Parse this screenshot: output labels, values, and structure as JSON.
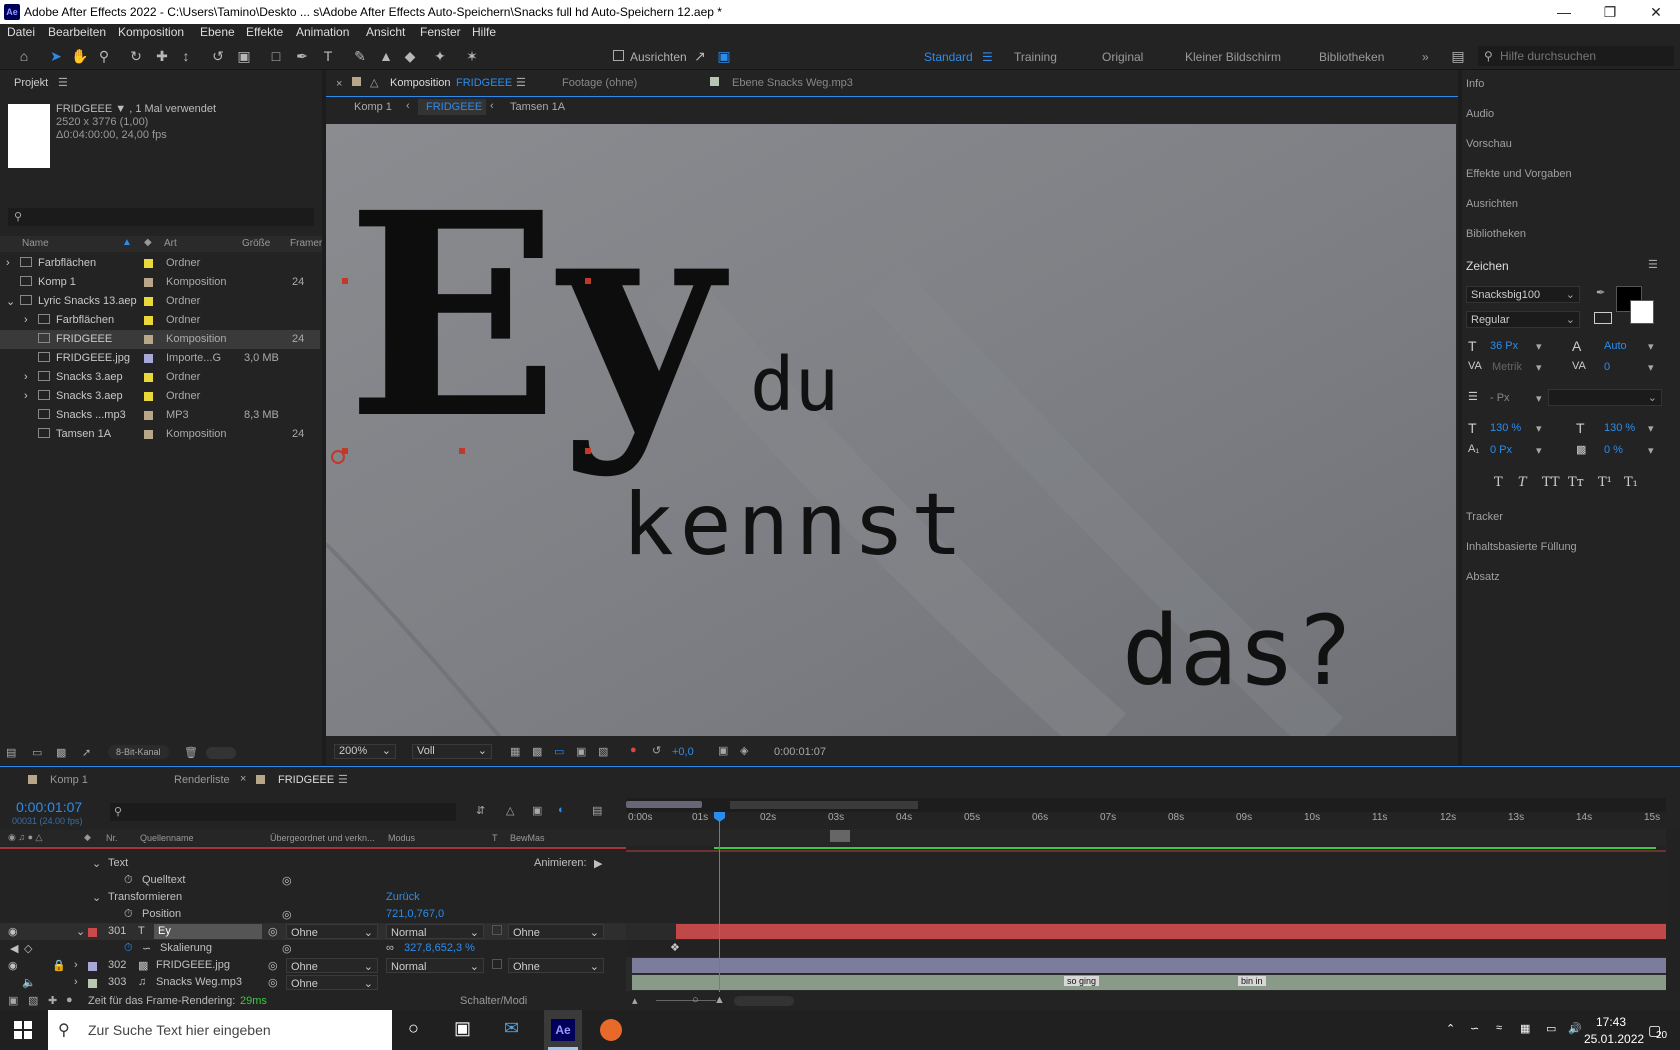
{
  "window": {
    "title": "Adobe After Effects 2022 - C:\\Users\\Tamino\\Deskto ... s\\Adobe After Effects Auto-Speichern\\Snacks full hd Auto-Speichern 12.aep *",
    "logo": "Ae"
  },
  "menu": [
    "Datei",
    "Bearbeiten",
    "Komposition",
    "Ebene",
    "Effekte",
    "Animation",
    "Ansicht",
    "Fenster",
    "Hilfe"
  ],
  "toolbar": {
    "snap_label": "Ausrichten",
    "workspaces": [
      "Standard",
      "Training",
      "Original",
      "Kleiner Bildschirm",
      "Bibliotheken"
    ],
    "help_placeholder": "Hilfe durchsuchen"
  },
  "project": {
    "title": "Projekt",
    "selected_name": "FRIDGEEE ▼ , 1 Mal verwendet",
    "selected_dims": "2520 x 3776 (1,00)",
    "selected_duration": "Δ0:04:00:00, 24,00 fps",
    "columns": [
      "Name",
      "Art",
      "Größe",
      "Framer"
    ],
    "items": [
      {
        "name": "Farbflächen",
        "type": "Ordner",
        "size": "",
        "fr": "",
        "indent": 0,
        "arrow": "›",
        "swatch": "#e8d83a"
      },
      {
        "name": "Komp 1",
        "type": "Komposition",
        "size": "",
        "fr": "24",
        "indent": 0,
        "arrow": "",
        "swatch": "#b8a68a"
      },
      {
        "name": "Lyric Snacks 13.aep",
        "type": "Ordner",
        "size": "",
        "fr": "",
        "indent": 0,
        "arrow": "⌄",
        "swatch": "#e8d83a"
      },
      {
        "name": "Farbflächen",
        "type": "Ordner",
        "size": "",
        "fr": "",
        "indent": 1,
        "arrow": "›",
        "swatch": "#e8d83a"
      },
      {
        "name": "FRIDGEEE",
        "type": "Komposition",
        "size": "",
        "fr": "24",
        "indent": 1,
        "arrow": "",
        "swatch": "#b8a68a"
      },
      {
        "name": "FRIDGEEE.jpg",
        "type": "Importe...G",
        "size": "3,0 MB",
        "fr": "",
        "indent": 1,
        "arrow": "",
        "swatch": "#a8a8d8"
      },
      {
        "name": "Snacks 3.aep",
        "type": "Ordner",
        "size": "",
        "fr": "",
        "indent": 1,
        "arrow": "›",
        "swatch": "#e8d83a"
      },
      {
        "name": "Snacks 3.aep",
        "type": "Ordner",
        "size": "",
        "fr": "",
        "indent": 1,
        "arrow": "›",
        "swatch": "#e8d83a"
      },
      {
        "name": "Snacks ...mp3",
        "type": "MP3",
        "size": "8,3 MB",
        "fr": "",
        "indent": 1,
        "arrow": "",
        "swatch": "#b8a68a"
      },
      {
        "name": "Tamsen 1A",
        "type": "Komposition",
        "size": "",
        "fr": "24",
        "indent": 1,
        "arrow": "",
        "swatch": "#b8a68a"
      }
    ],
    "bit_depth": "8-Bit-Kanal"
  },
  "comp": {
    "tab_prefix": "Komposition",
    "tab_name": "FRIDGEEE",
    "footage_tab": "Footage (ohne)",
    "layer_tab": "Ebene Snacks Weg.mp3",
    "breadcrumbs": [
      "Komp 1",
      "FRIDGEEE",
      "Tamsen 1A"
    ],
    "words": [
      "Ey",
      "du",
      "kennst",
      "das?"
    ],
    "zoom": "200%",
    "resolution": "Voll",
    "exposure": "+0,0",
    "timecode": "0:00:01:07"
  },
  "right_panel": {
    "items_top": [
      "Info",
      "Audio",
      "Vorschau",
      "Effekte und Vorgaben",
      "Ausrichten",
      "Bibliotheken"
    ],
    "zeichen": "Zeichen",
    "font": "Snacksbig100",
    "style": "Regular",
    "size": "36 Px",
    "leading": "Auto",
    "kerning": "Metrik",
    "tracking": "0",
    "stroke": "- Px",
    "vscale": "130 %",
    "hscale": "130 %",
    "baseline": "0 Px",
    "tsume": "0 %",
    "text_styles": [
      "T",
      "T",
      "TT",
      "Tт",
      "T¹",
      "T₁"
    ],
    "items_bottom": [
      "Tracker",
      "Inhaltsbasierte Füllung",
      "Absatz"
    ]
  },
  "timeline": {
    "tabs": [
      "Komp 1",
      "Renderliste",
      "FRIDGEEE"
    ],
    "timecode": "0:00:01:07",
    "subcode": "00031 (24.00 fps)",
    "columns": {
      "nr": "Nr.",
      "source": "Quellenname",
      "parent": "Übergeordnet und verkn...",
      "mode": "Modus",
      "t": "T",
      "trkmat": "BewMas"
    },
    "prop_text": "Text",
    "animate": "Animieren:",
    "prop_source_text": "Quelltext",
    "prop_transform": "Transformieren",
    "reset": "Zurück",
    "prop_position": "Position",
    "position_value": "721,0,767,0",
    "prop_scale": "Skalierung",
    "scale_value": "327,8,652,3 %",
    "layers": [
      {
        "nr": "301",
        "name": "Ey",
        "parent": "Ohne",
        "mode": "Normal",
        "trk": "Ohne",
        "color": "#c84a4a"
      },
      {
        "nr": "302",
        "name": "FRIDGEEE.jpg",
        "parent": "Ohne",
        "mode": "Normal",
        "trk": "Ohne",
        "color": "#a8a8d8"
      },
      {
        "nr": "303",
        "name": "Snacks Weg.mp3",
        "parent": "Ohne",
        "mode": "",
        "trk": "",
        "color": "#b8c8b0"
      }
    ],
    "ticks": [
      "0:00s",
      "01s",
      "02s",
      "03s",
      "04s",
      "05s",
      "06s",
      "07s",
      "08s",
      "09s",
      "10s",
      "11s",
      "12s",
      "13s",
      "14s",
      "15s"
    ],
    "markers": [
      "so ging",
      "bin in"
    ],
    "footer_render": "Zeit für das Frame-Rendering:",
    "footer_ms": "29ms",
    "footer_toggle": "Schalter/Modi"
  },
  "taskbar": {
    "search": "Zur Suche Text hier eingeben",
    "time": "17:43",
    "date": "25.01.2022",
    "notif": "20"
  }
}
